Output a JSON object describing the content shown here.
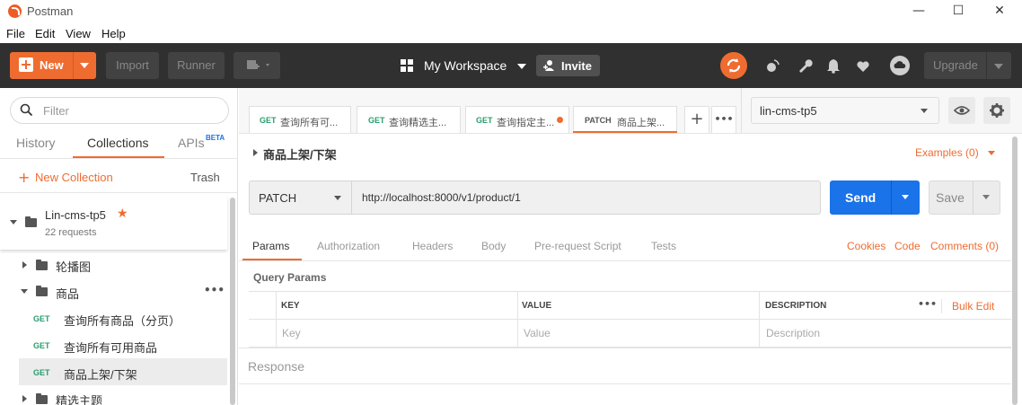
{
  "window": {
    "title": "Postman"
  },
  "menu": [
    "File",
    "Edit",
    "View",
    "Help"
  ],
  "header": {
    "new_label": "New",
    "import_label": "Import",
    "runner_label": "Runner",
    "workspace_label": "My Workspace",
    "invite_label": "Invite",
    "upgrade_label": "Upgrade",
    "accent": "#ef6c31"
  },
  "sidebar": {
    "filter_placeholder": "Filter",
    "tabs": [
      {
        "label": "History"
      },
      {
        "label": "Collections",
        "active": true
      },
      {
        "label": "APIs",
        "badge": "BETA"
      }
    ],
    "new_collection_label": "New Collection",
    "trash_label": "Trash",
    "collection": {
      "name": "Lin-cms-tp5",
      "requests": "22 requests",
      "starred": true
    },
    "tree": [
      {
        "type": "folder",
        "label": "轮播图",
        "expanded": false
      },
      {
        "type": "folder",
        "label": "商品",
        "expanded": true,
        "more": "•••"
      },
      {
        "type": "request",
        "method": "GET",
        "label": "查询所有商品（分页）"
      },
      {
        "type": "request",
        "method": "GET",
        "label": "查询所有可用商品"
      },
      {
        "type": "request",
        "method": "GET",
        "label": "商品上架/下架",
        "selected": true
      },
      {
        "type": "folder",
        "label": "精选主题",
        "expanded": false
      }
    ]
  },
  "tabs": [
    {
      "method": "GET",
      "title": "查询所有可...",
      "method_color": "#2a9d6e",
      "dirty": false
    },
    {
      "method": "GET",
      "title": "查询精选主...",
      "method_color": "#2a9d6e",
      "dirty": false
    },
    {
      "method": "GET",
      "title": "查询指定主...",
      "method_color": "#2a9d6e",
      "dirty": true
    },
    {
      "method": "PATCH",
      "title": "商品上架...",
      "method_color": "#555555",
      "dirty": false,
      "active": true
    }
  ],
  "tab_actions": {
    "add": "+",
    "more": "•••"
  },
  "environment": {
    "selected": "lin-cms-tp5"
  },
  "request": {
    "name": "商品上架/下架",
    "examples_label": "Examples (0)",
    "method": "PATCH",
    "url": "http://localhost:8000/v1/product/1",
    "send_label": "Send",
    "save_label": "Save"
  },
  "subtabs": [
    {
      "label": "Params",
      "active": true
    },
    {
      "label": "Authorization"
    },
    {
      "label": "Headers"
    },
    {
      "label": "Body"
    },
    {
      "label": "Pre-request Script"
    },
    {
      "label": "Tests"
    }
  ],
  "subtab_links": {
    "cookies": "Cookies",
    "code": "Code",
    "comments": "Comments (0)"
  },
  "params": {
    "title": "Query Params",
    "columns": {
      "key": "KEY",
      "value": "VALUE",
      "description": "DESCRIPTION"
    },
    "more": "•••",
    "bulk_edit": "Bulk Edit",
    "placeholders": {
      "key": "Key",
      "value": "Value",
      "description": "Description"
    }
  },
  "response": {
    "label": "Response"
  }
}
